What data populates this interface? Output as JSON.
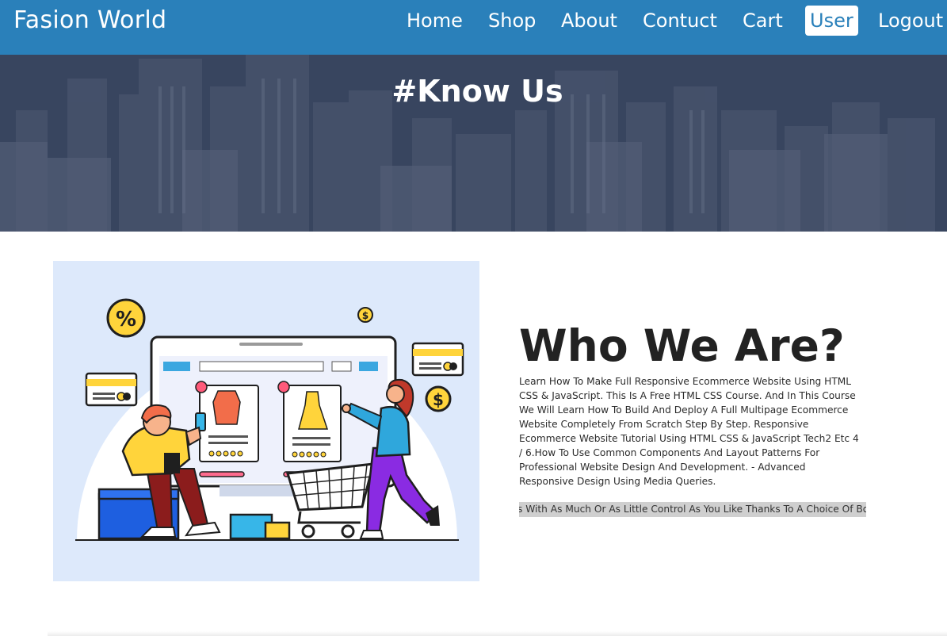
{
  "navbar": {
    "brand": "Fasion World",
    "links": [
      {
        "label": "Home",
        "active": false
      },
      {
        "label": "Shop",
        "active": false
      },
      {
        "label": "About",
        "active": false
      },
      {
        "label": "Contuct",
        "active": false
      },
      {
        "label": "Cart",
        "active": false
      },
      {
        "label": "User",
        "active": true
      },
      {
        "label": "Logout",
        "active": false
      }
    ]
  },
  "hero": {
    "title": "#Know Us"
  },
  "about": {
    "heading": "Who We Are?",
    "paragraph": "Learn How To Make Full Responsive Ecommerce Website Using HTML CSS & JavaScript. This Is A Free HTML CSS Course. And In This Course We Will Learn How To Build And Deploy A Full Multipage Ecommerce Website Completely From Scratch Step By Step. Responsive Ecommerce Website Tutorial Using HTML CSS & JavaScript Tech2 Etc 4 / 6.How To Use Common Components And Layout Patterns For Professional Website Design And Development. - Advanced Responsive Design Using Media Queries.",
    "marquee": "s With As Much Or As Little Control As You Like Thanks To A Choice Of Bo"
  },
  "colors": {
    "nav_bg": "#2a80ba",
    "hero_bg": "#3a475f",
    "illustration_bg": "#dde9fb"
  },
  "icons": [
    "percent-icon",
    "dollar-icon",
    "heart-icon",
    "shopping-cart-icon",
    "credit-card-icon"
  ]
}
